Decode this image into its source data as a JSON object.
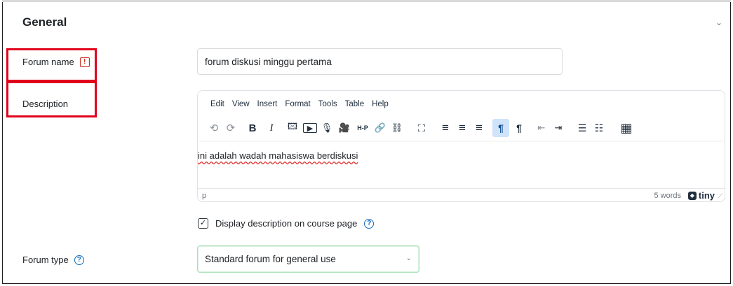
{
  "section": {
    "title": "General",
    "collapse_icon": "chevron-down-icon"
  },
  "forum_name": {
    "label": "Forum name",
    "required_icon": "!",
    "value": "forum diskusi minggu pertama"
  },
  "description": {
    "label": "Description",
    "editor": {
      "menu": [
        "Edit",
        "View",
        "Insert",
        "Format",
        "Tools",
        "Table",
        "Help"
      ],
      "toolbar": {
        "undo": "⟲",
        "redo": "⟳",
        "bold": "B",
        "italic": "I",
        "image": "🖾",
        "media": "▶",
        "record_audio": "🎙",
        "record_video": "🎥",
        "h5p": "H-P",
        "link": "🔗",
        "unlink": "⛓",
        "fullscreen": "⛶",
        "align_left": "≡",
        "align_center": "≡",
        "align_right": "≡",
        "ltr": "¶",
        "rtl": "¶",
        "outdent": "⇤",
        "indent": "⇥",
        "bullet_list": "☰",
        "numbered_list": "☷",
        "calculator": "▦"
      },
      "content": "ini adalah wadah mahasiswa berdiskusi",
      "path": "p",
      "word_count": "5 words",
      "brand": "tiny"
    }
  },
  "display_description": {
    "label": "Display description on course page",
    "checked": true,
    "check_glyph": "✓",
    "help_icon": "?"
  },
  "forum_type": {
    "label": "Forum type",
    "help_icon": "?",
    "selected": "Standard forum for general use",
    "chevron": "⌄"
  },
  "colors": {
    "required": "#ca3120",
    "help": "#0f6cbf",
    "highlight_box": "#e0001b",
    "select_focus": "#a9dfb8"
  }
}
